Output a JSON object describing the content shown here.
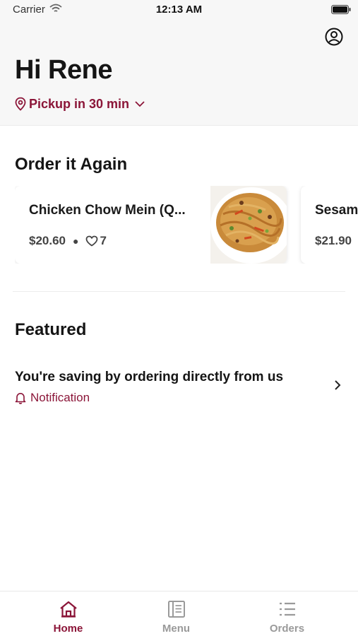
{
  "status_bar": {
    "carrier": "Carrier",
    "time": "12:13 AM"
  },
  "header": {
    "greeting": "Hi Rene",
    "pickup_label": "Pickup in 30 min",
    "profile_icon": "user-circle-icon"
  },
  "order_again": {
    "title": "Order it Again",
    "items": [
      {
        "name": "Chicken Chow Mein (Q...",
        "price": "$20.60",
        "likes": "7",
        "image": "chow-mein-photo"
      },
      {
        "name": "Sesam",
        "price": "$21.90"
      }
    ]
  },
  "featured": {
    "title": "Featured",
    "item_title": "You're saving by ordering directly from us",
    "item_subtitle": "Notification"
  },
  "tabs": [
    {
      "label": "Home",
      "icon": "home-icon",
      "active": true
    },
    {
      "label": "Menu",
      "icon": "menu-book-icon",
      "active": false
    },
    {
      "label": "Orders",
      "icon": "list-icon",
      "active": false
    }
  ],
  "colors": {
    "accent": "#8b1538",
    "inactive": "#9a9a9a",
    "header_bg": "#f7f7f7"
  }
}
